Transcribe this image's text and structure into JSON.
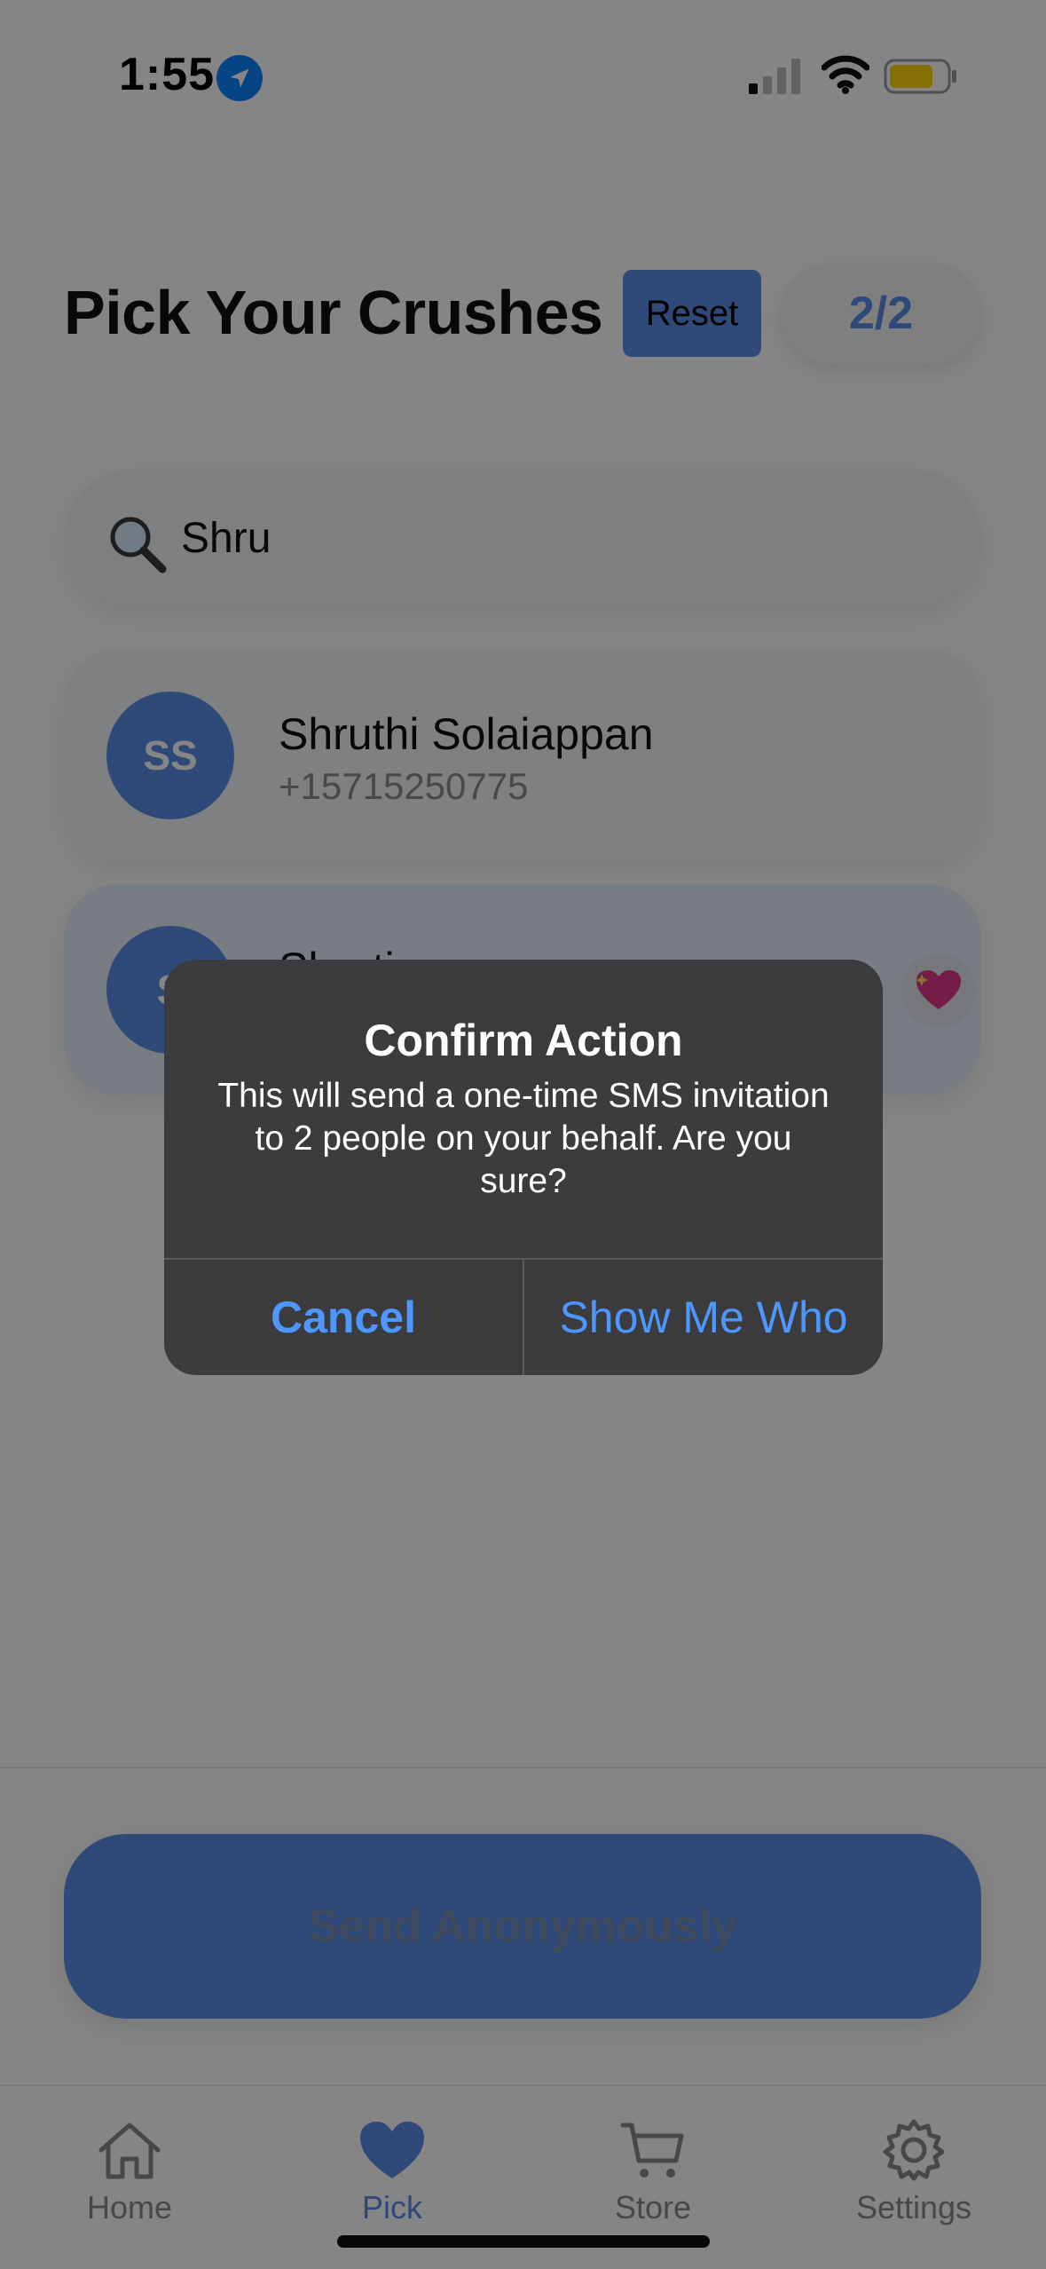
{
  "status_bar": {
    "time": "1:55",
    "location_icon": "location-arrow-icon",
    "signal_icon": "cellular-signal-icon",
    "wifi_icon": "wifi-icon",
    "battery_icon": "battery-icon",
    "battery_color": "#ffd60a"
  },
  "header": {
    "title": "Pick Your Crushes",
    "reset_label": "Reset",
    "count": "2/2"
  },
  "search": {
    "value": "Shru",
    "icon": "magnifying-glass-icon"
  },
  "contacts": [
    {
      "initials": "SS",
      "name": "Shruthi Solaiappan",
      "phone": "+15715250775",
      "selected": false
    },
    {
      "initials": "S",
      "name": "Shruti",
      "selected": true,
      "badge_icon": "sparkling-heart-icon"
    }
  ],
  "send_button": {
    "label": "Send Anonymously"
  },
  "tabs": [
    {
      "label": "Home",
      "icon": "house-icon",
      "active": false
    },
    {
      "label": "Pick",
      "icon": "heart-icon",
      "active": true
    },
    {
      "label": "Store",
      "icon": "cart-icon",
      "active": false
    },
    {
      "label": "Settings",
      "icon": "gear-icon",
      "active": false
    }
  ],
  "alert": {
    "title": "Confirm Action",
    "message": "This will send a one-time SMS invitation to 2 people on your behalf. Are you sure?",
    "cancel_label": "Cancel",
    "confirm_label": "Show Me Who"
  },
  "colors": {
    "accent": "#5b8de8",
    "alert_background": "#3c3c3e",
    "alert_button": "#4d97ff"
  }
}
